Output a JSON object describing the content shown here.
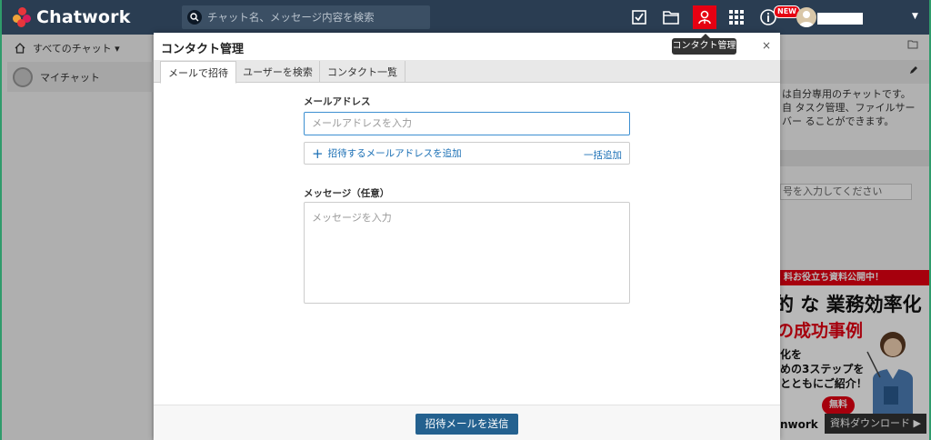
{
  "header": {
    "logo_text": "Chatwork",
    "search_placeholder": "チャット名、メッセージ内容を検索",
    "new_badge": "NEW",
    "icons": [
      "task-icon",
      "file-icon",
      "contact-icon",
      "apps-icon",
      "info-icon",
      "avatar"
    ]
  },
  "tooltip": "コンタクト管理",
  "sidebar": {
    "filter_label": "すべてのチャット ▾",
    "mychat_label": "マイチャット"
  },
  "right_panel": {
    "description": "は自分専用のチャットです。自 タスク管理、ファイルサーバー ることができます。",
    "input_placeholder": "号を入力してください"
  },
  "ad": {
    "banner": "料お役立ち資料公開中！",
    "title": "的 な 業務効率化",
    "subtitle": "の成功事例",
    "body1": "化を",
    "body2": "めの3ステップを",
    "body3": "とともにご紹介！",
    "free": "無料",
    "brand": "nwork",
    "download": "資料ダウンロード ▶"
  },
  "modal": {
    "title": "コンタクト管理",
    "close": "×",
    "tabs": [
      "メールで招待",
      "ユーザーを検索",
      "コンタクト一覧"
    ],
    "active_tab": 0,
    "email_label": "メールアドレス",
    "email_placeholder": "メールアドレスを入力",
    "add_email_label": "招待するメールアドレスを追加",
    "bulk_add_label": "一括追加",
    "message_label": "メッセージ（任意）",
    "message_placeholder": "メッセージを入力",
    "send_button": "招待メールを送信"
  },
  "colors": {
    "header_bg": "#2a3d52",
    "accent_red": "#e60012",
    "link_blue": "#1a6fb5",
    "send_button_bg": "#24618f",
    "focus_border": "#3d8fd1"
  }
}
